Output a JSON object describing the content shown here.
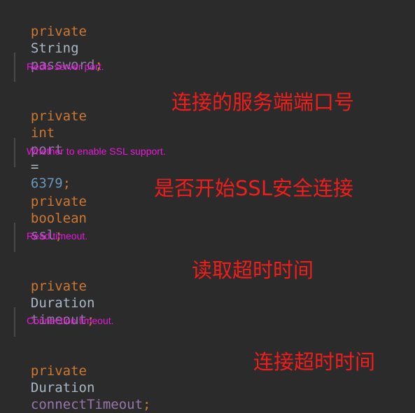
{
  "lines": [
    {
      "kw": "private",
      "type": "String",
      "field": "password",
      "end": ";"
    },
    {
      "kw": "private",
      "type": "int",
      "field": "port",
      "assign": "=",
      "value": "6379",
      "end": ";"
    },
    {
      "kw": "private",
      "type": "boolean",
      "field": "ssl",
      "end": ";"
    },
    {
      "kw": "private",
      "type": "Duration",
      "field": "timeout",
      "end": ";"
    },
    {
      "kw": "private",
      "type": "Duration",
      "field": "connectTimeout",
      "end": ";"
    }
  ],
  "docs": [
    "Redis server port.",
    "Whether to enable SSL support.",
    "Read timeout.",
    "Connection timeout."
  ],
  "annotations": [
    "连接的服务端端口号",
    "是否开始SSL安全连接",
    "读取超时时间",
    "连接超时时间"
  ]
}
